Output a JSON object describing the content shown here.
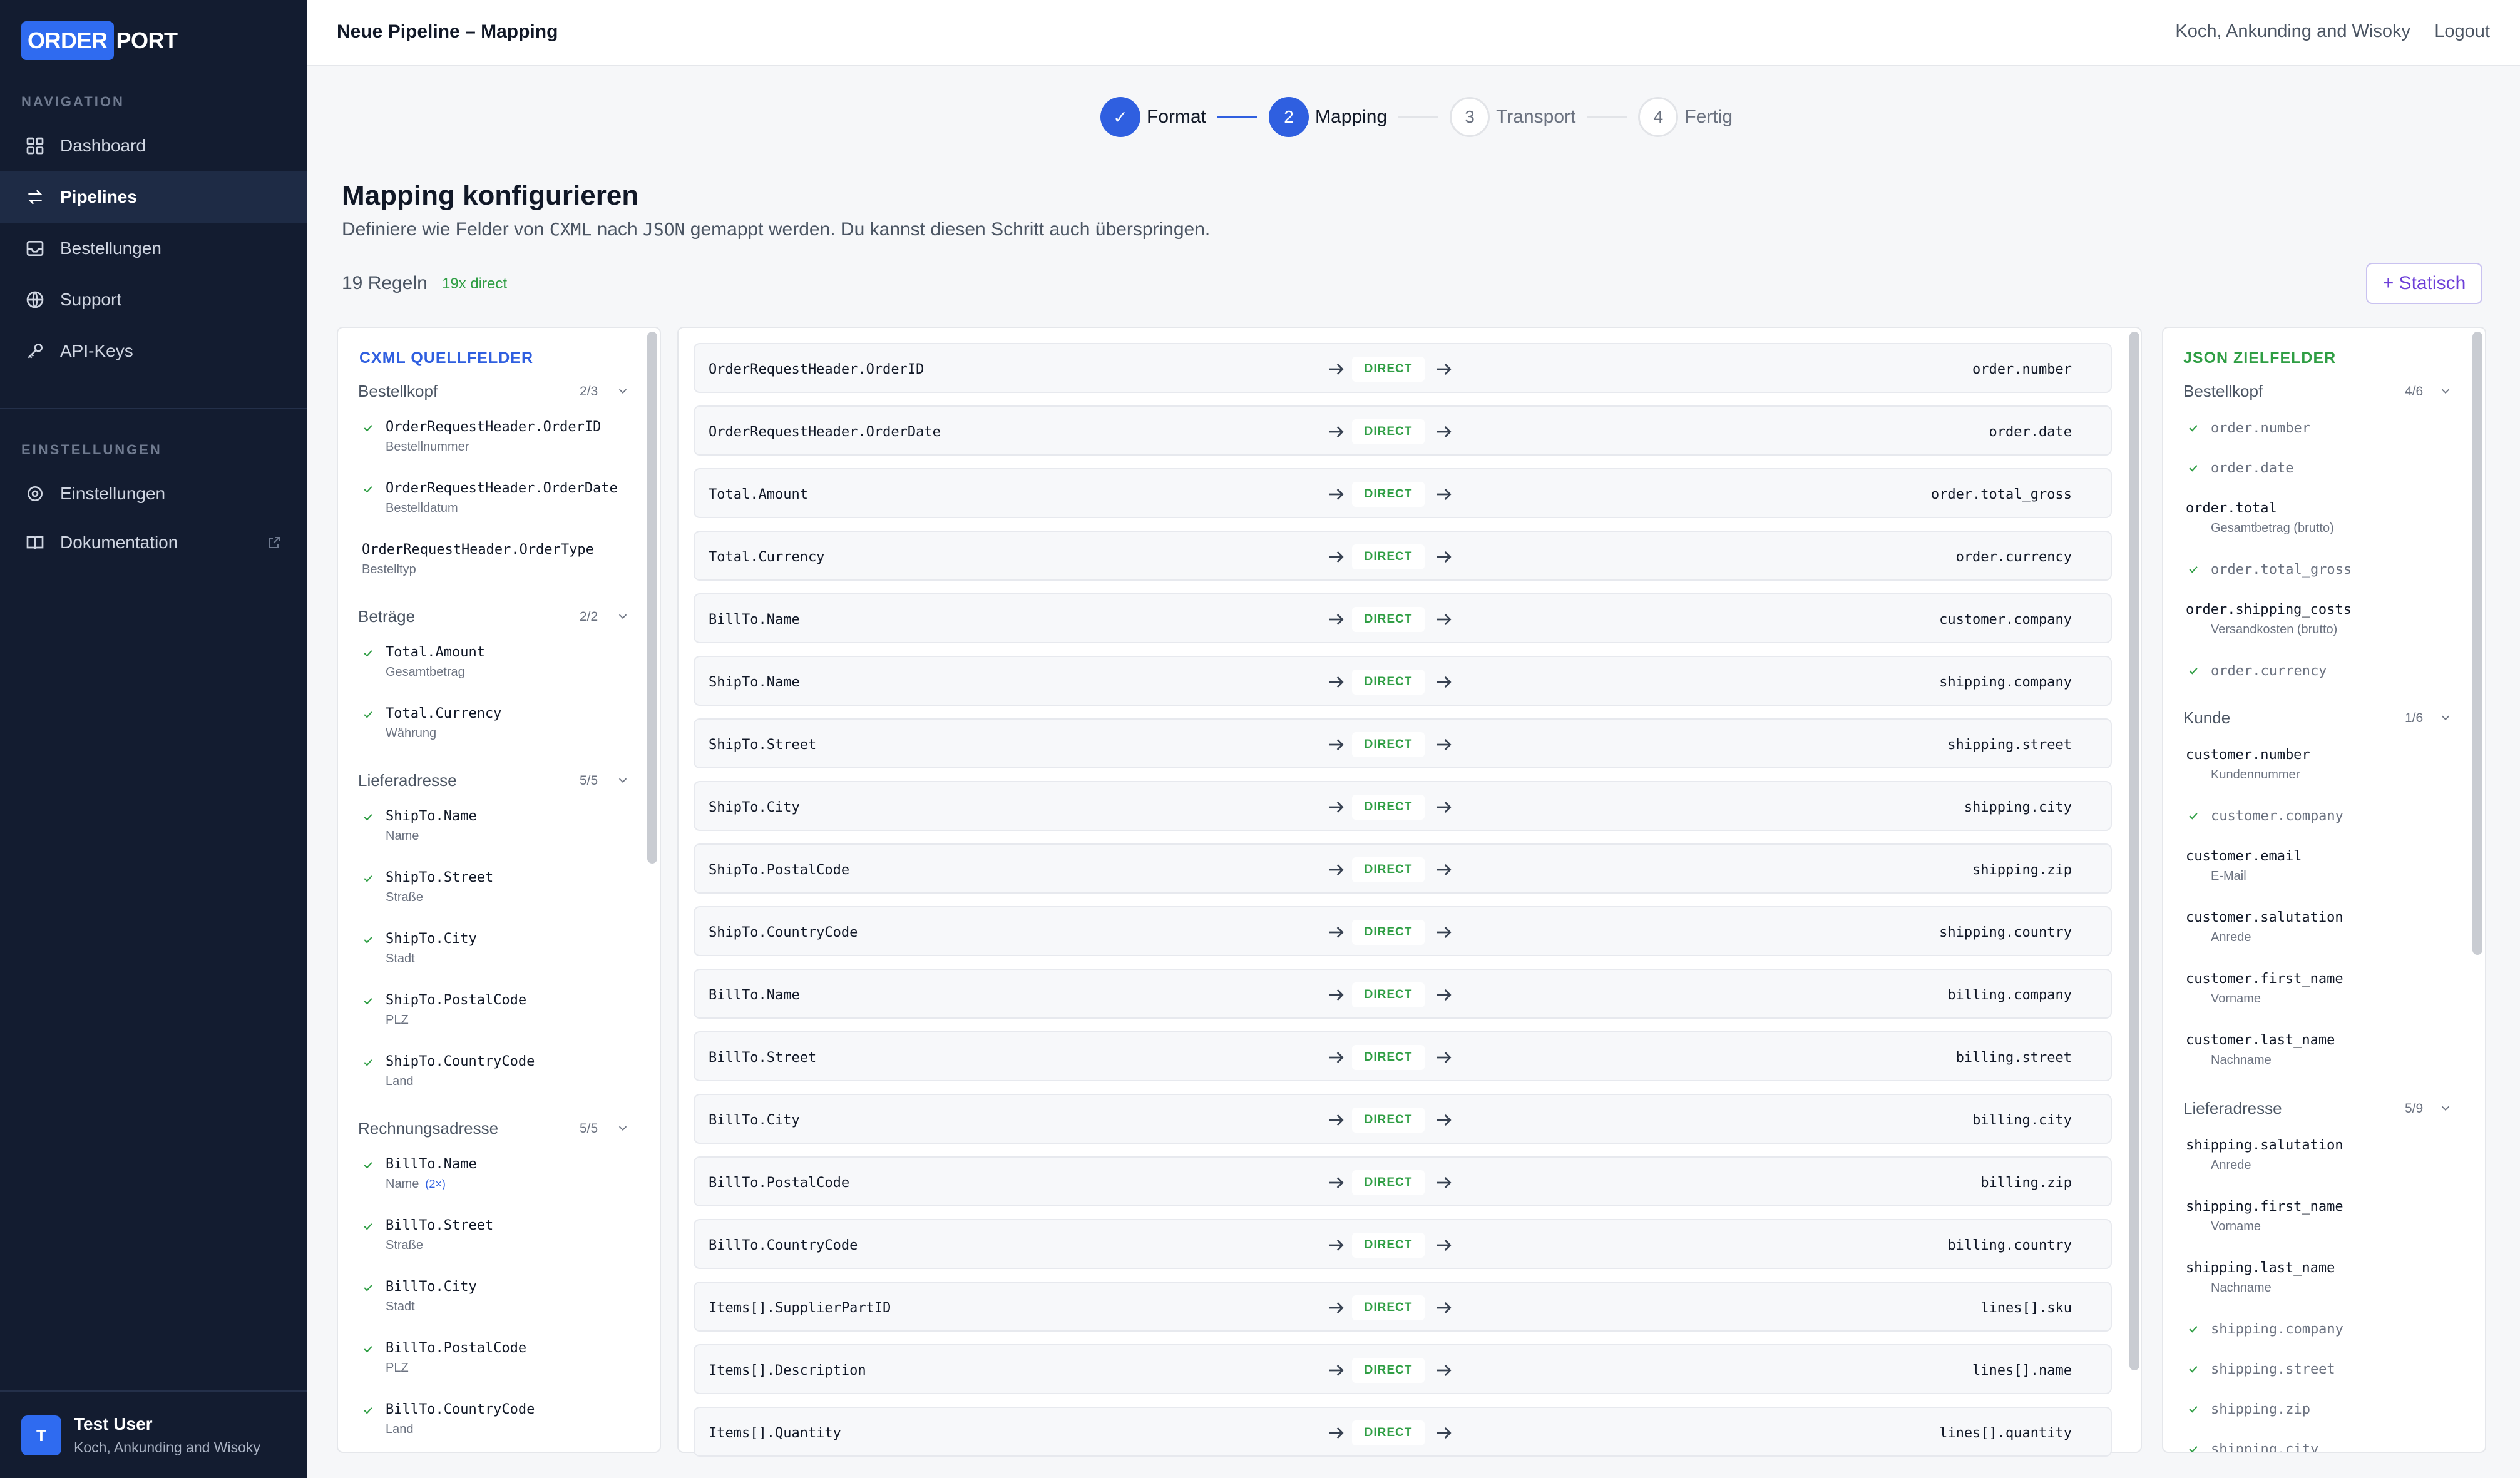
{
  "logo": {
    "part1": "ORDER",
    "part2": "PORT"
  },
  "nav": {
    "section1": "NAVIGATION",
    "items": [
      {
        "label": "Dashboard",
        "icon": "grid-icon"
      },
      {
        "label": "Pipelines",
        "icon": "arrows-icon"
      },
      {
        "label": "Bestellungen",
        "icon": "inbox-icon"
      },
      {
        "label": "Support",
        "icon": "globe-icon"
      },
      {
        "label": "API-Keys",
        "icon": "key-icon"
      }
    ],
    "section2": "EINSTELLUNGEN",
    "items2": [
      {
        "label": "Einstellungen",
        "icon": "gear-icon"
      },
      {
        "label": "Dokumentation",
        "icon": "book-icon"
      }
    ]
  },
  "user": {
    "initial": "T",
    "name": "Test User",
    "company": "Koch, Ankunding and Wisoky"
  },
  "header": {
    "title": "Neue Pipeline – Mapping",
    "company": "Koch, Ankunding and Wisoky",
    "logout": "Logout"
  },
  "stepper": [
    {
      "num": "✓",
      "label": "Format",
      "state": "done"
    },
    {
      "num": "2",
      "label": "Mapping",
      "state": "current"
    },
    {
      "num": "3",
      "label": "Transport",
      "state": "todo"
    },
    {
      "num": "4",
      "label": "Fertig",
      "state": "todo"
    }
  ],
  "page": {
    "title": "Mapping konfigurieren",
    "sub_a": "Definiere wie Felder von ",
    "sub_b": "CXML",
    "sub_c": " nach ",
    "sub_d": "JSON",
    "sub_e": " gemappt werden. Du kannst diesen Schritt auch überspringen.",
    "rules": "19 Regeln",
    "direct_badge": "19x direct",
    "static_button": "+ Statisch"
  },
  "source": {
    "title": "CXML QUELLFELDER",
    "groups": [
      {
        "name": "Bestellkopf",
        "count": "2/3",
        "fields": [
          {
            "name": "OrderRequestHeader.OrderID",
            "sub": "Bestellnummer",
            "mapped": true
          },
          {
            "name": "OrderRequestHeader.OrderDate",
            "sub": "Bestelldatum",
            "mapped": true
          },
          {
            "name": "OrderRequestHeader.OrderType",
            "sub": "Bestelltyp",
            "mapped": false
          }
        ]
      },
      {
        "name": "Beträge",
        "count": "2/2",
        "fields": [
          {
            "name": "Total.Amount",
            "sub": "Gesamtbetrag",
            "mapped": true
          },
          {
            "name": "Total.Currency",
            "sub": "Währung",
            "mapped": true
          }
        ]
      },
      {
        "name": "Lieferadresse",
        "count": "5/5",
        "fields": [
          {
            "name": "ShipTo.Name",
            "sub": "Name",
            "mapped": true
          },
          {
            "name": "ShipTo.Street",
            "sub": "Straße",
            "mapped": true
          },
          {
            "name": "ShipTo.City",
            "sub": "Stadt",
            "mapped": true
          },
          {
            "name": "ShipTo.PostalCode",
            "sub": "PLZ",
            "mapped": true
          },
          {
            "name": "ShipTo.CountryCode",
            "sub": "Land",
            "mapped": true
          }
        ]
      },
      {
        "name": "Rechnungsadresse",
        "count": "5/5",
        "fields": [
          {
            "name": "BillTo.Name",
            "sub": "Name",
            "mult": "(2×)",
            "mapped": true
          },
          {
            "name": "BillTo.Street",
            "sub": "Straße",
            "mapped": true
          },
          {
            "name": "BillTo.City",
            "sub": "Stadt",
            "mapped": true
          },
          {
            "name": "BillTo.PostalCode",
            "sub": "PLZ",
            "mapped": true
          },
          {
            "name": "BillTo.CountryCode",
            "sub": "Land",
            "mapped": true
          }
        ]
      }
    ]
  },
  "mappings": {
    "type_label": "DIRECT",
    "rows": [
      {
        "src": "OrderRequestHeader.OrderID",
        "tgt": "order.number"
      },
      {
        "src": "OrderRequestHeader.OrderDate",
        "tgt": "order.date"
      },
      {
        "src": "Total.Amount",
        "tgt": "order.total_gross"
      },
      {
        "src": "Total.Currency",
        "tgt": "order.currency"
      },
      {
        "src": "BillTo.Name",
        "tgt": "customer.company"
      },
      {
        "src": "ShipTo.Name",
        "tgt": "shipping.company"
      },
      {
        "src": "ShipTo.Street",
        "tgt": "shipping.street"
      },
      {
        "src": "ShipTo.City",
        "tgt": "shipping.city"
      },
      {
        "src": "ShipTo.PostalCode",
        "tgt": "shipping.zip"
      },
      {
        "src": "ShipTo.CountryCode",
        "tgt": "shipping.country"
      },
      {
        "src": "BillTo.Name",
        "tgt": "billing.company"
      },
      {
        "src": "BillTo.Street",
        "tgt": "billing.street"
      },
      {
        "src": "BillTo.City",
        "tgt": "billing.city"
      },
      {
        "src": "BillTo.PostalCode",
        "tgt": "billing.zip"
      },
      {
        "src": "BillTo.CountryCode",
        "tgt": "billing.country"
      },
      {
        "src": "Items[].SupplierPartID",
        "tgt": "lines[].sku"
      },
      {
        "src": "Items[].Description",
        "tgt": "lines[].name"
      },
      {
        "src": "Items[].Quantity",
        "tgt": "lines[].quantity"
      }
    ]
  },
  "target": {
    "title": "JSON ZIELFELDER",
    "groups": [
      {
        "name": "Bestellkopf",
        "count": "4/6",
        "fields": [
          {
            "name": "order.number",
            "mapped": true
          },
          {
            "name": "order.date",
            "mapped": true
          },
          {
            "name": "order.total",
            "sub": "Gesamtbetrag (brutto)",
            "mapped": false
          },
          {
            "name": "order.total_gross",
            "mapped": true
          },
          {
            "name": "order.shipping_costs",
            "sub": "Versandkosten (brutto)",
            "mapped": false
          },
          {
            "name": "order.currency",
            "mapped": true
          }
        ]
      },
      {
        "name": "Kunde",
        "count": "1/6",
        "fields": [
          {
            "name": "customer.number",
            "sub": "Kundennummer",
            "mapped": false
          },
          {
            "name": "customer.company",
            "mapped": true
          },
          {
            "name": "customer.email",
            "sub": "E-Mail",
            "mapped": false
          },
          {
            "name": "customer.salutation",
            "sub": "Anrede",
            "mapped": false
          },
          {
            "name": "customer.first_name",
            "sub": "Vorname",
            "mapped": false
          },
          {
            "name": "customer.last_name",
            "sub": "Nachname",
            "mapped": false
          }
        ]
      },
      {
        "name": "Lieferadresse",
        "count": "5/9",
        "fields": [
          {
            "name": "shipping.salutation",
            "sub": "Anrede",
            "mapped": false
          },
          {
            "name": "shipping.first_name",
            "sub": "Vorname",
            "mapped": false
          },
          {
            "name": "shipping.last_name",
            "sub": "Nachname",
            "mapped": false
          },
          {
            "name": "shipping.company",
            "mapped": true
          },
          {
            "name": "shipping.street",
            "mapped": true
          },
          {
            "name": "shipping.zip",
            "mapped": true
          },
          {
            "name": "shipping.city",
            "mapped": true
          }
        ]
      }
    ]
  },
  "colors": {
    "accent": "#2f5fe0",
    "sidebar": "#131c30",
    "success": "#2f9e44",
    "static": "#6d3fd8"
  }
}
